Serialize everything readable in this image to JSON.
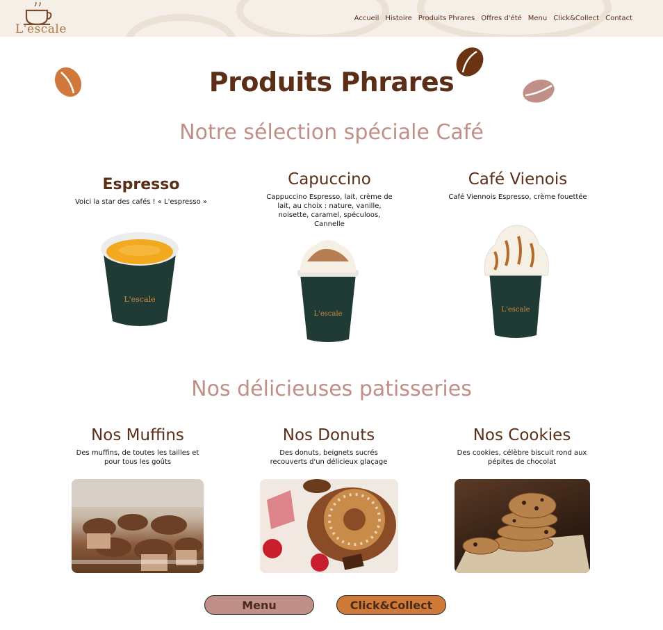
{
  "brand": {
    "logo_text": "L'escale"
  },
  "nav": [
    "Accueil",
    "Histoire",
    "Produits Phrares",
    "Offres d'été",
    "Menu",
    "Click&Collect",
    "Contact"
  ],
  "page_title": "Produits Phrares",
  "coffee_section": {
    "heading": "Notre sélection spéciale Café",
    "items": [
      {
        "title": "Espresso",
        "desc": "Voici la star des cafés ! « L'espresso »"
      },
      {
        "title": "Capuccino",
        "desc": "Cappuccino Espresso, lait, crème de lait, au choix : nature, vanille, noisette, caramel, spéculoos, Cannelle"
      },
      {
        "title": "Café Vienois",
        "desc": "Café Viennois Espresso, crème fouettée"
      }
    ],
    "cup_logo_text": "L'escale"
  },
  "pastry_section": {
    "heading": "Nos délicieuses patisseries",
    "items": [
      {
        "title": "Nos Muffins",
        "desc": "Des muffins, de toutes les tailles et pour tous les goûts"
      },
      {
        "title": "Nos Donuts",
        "desc": "Des donuts, beignets sucrés recouverts d'un délicieux glaçage"
      },
      {
        "title": "Nos Cookies",
        "desc": "Des cookies, célèbre biscuit rond aux pépites de chocolat"
      }
    ]
  },
  "buttons": {
    "menu": "Menu",
    "click_collect": "Click&Collect"
  },
  "colors": {
    "brown": "#5a2e17",
    "rose": "#c08f88",
    "orange": "#d07a3a",
    "cup": "#203a36"
  }
}
